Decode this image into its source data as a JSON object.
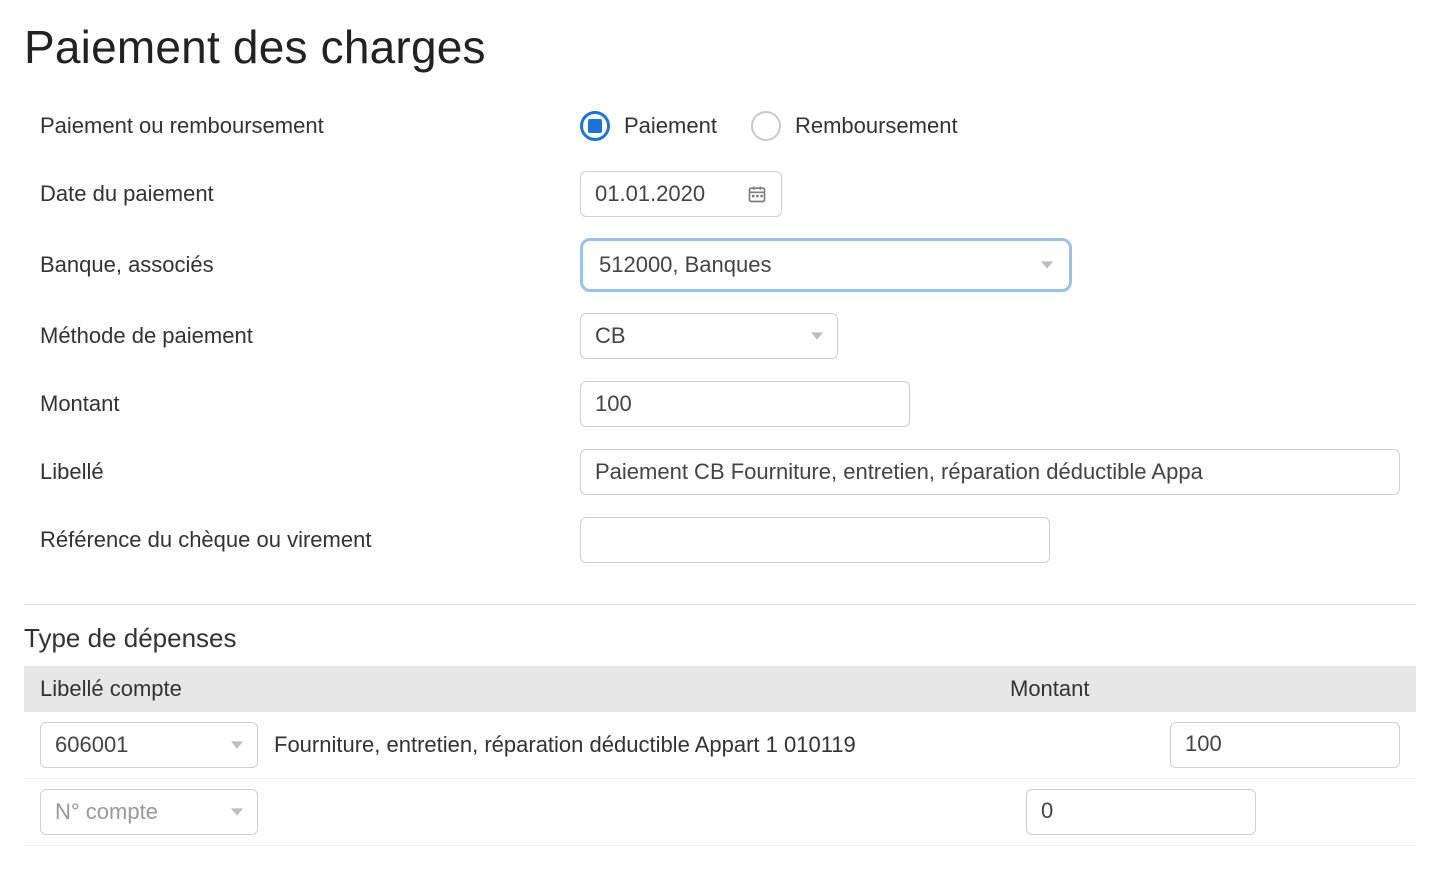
{
  "title": "Paiement des charges",
  "form": {
    "type_label": "Paiement ou remboursement",
    "type_options": {
      "paiement": "Paiement",
      "remboursement": "Remboursement"
    },
    "date_label": "Date du paiement",
    "date_value": "01.01.2020",
    "banque_label": "Banque, associés",
    "banque_value": "512000, Banques",
    "methode_label": "Méthode de paiement",
    "methode_value": "CB",
    "montant_label": "Montant",
    "montant_value": "100",
    "libelle_label": "Libellé",
    "libelle_value": "Paiement CB Fourniture, entretien, réparation déductible Appa",
    "reference_label": "Référence du chèque ou virement",
    "reference_value": ""
  },
  "expenses": {
    "heading": "Type de dépenses",
    "col_libelle": "Libellé compte",
    "col_montant": "Montant",
    "rows": [
      {
        "account": "606001",
        "description": "Fourniture, entretien, réparation déductible Appart 1 010119",
        "amount": "100"
      },
      {
        "account_placeholder": "N° compte",
        "description": "",
        "amount": "0"
      }
    ]
  }
}
